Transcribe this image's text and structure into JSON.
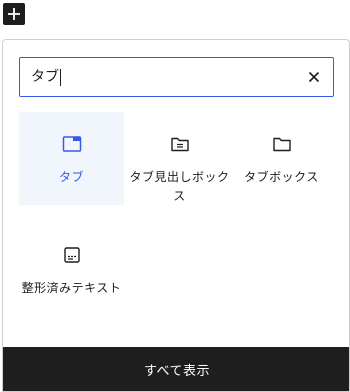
{
  "search": {
    "value": "タブ"
  },
  "blocks": [
    {
      "label": "タブ",
      "icon": "tab-window-icon",
      "selected": true
    },
    {
      "label": "タブ見出しボックス",
      "icon": "folder-lines-icon",
      "selected": false
    },
    {
      "label": "タブボックス",
      "icon": "folder-icon",
      "selected": false
    },
    {
      "label": "整形済みテキスト",
      "icon": "preformatted-text-icon",
      "selected": false
    }
  ],
  "footer": {
    "browse_all_label": "すべて表示"
  },
  "colors": {
    "accent": "#3858e9",
    "selected_bg": "#f0f6fc",
    "footer_bg": "#1e1e1e"
  }
}
